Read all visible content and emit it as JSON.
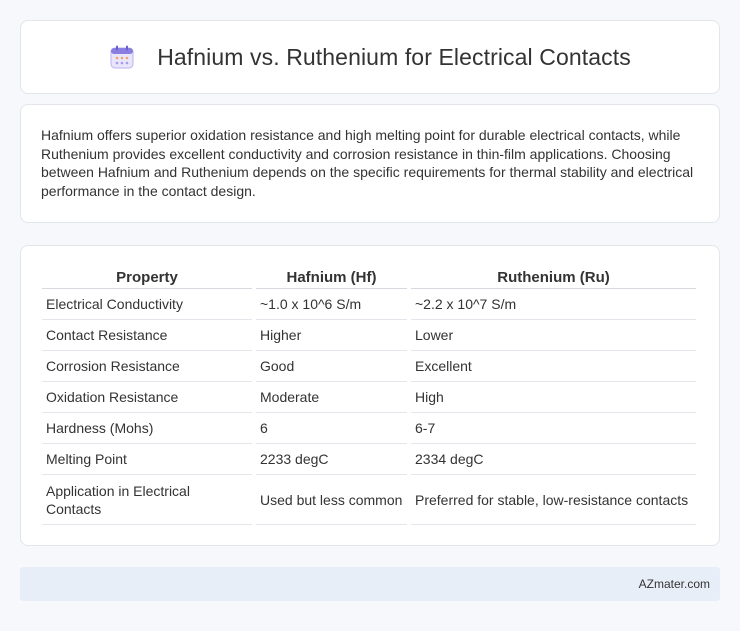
{
  "header": {
    "icon": "calendar-icon",
    "title": "Hafnium vs. Ruthenium for Electrical Contacts"
  },
  "intro": {
    "text": "Hafnium offers superior oxidation resistance and high melting point for durable electrical contacts, while Ruthenium provides excellent conductivity and corrosion resistance in thin-film applications. Choosing between Hafnium and Ruthenium depends on the specific requirements for thermal stability and electrical performance in the contact design."
  },
  "table": {
    "headers": [
      "Property",
      "Hafnium (Hf)",
      "Ruthenium (Ru)"
    ],
    "rows": [
      [
        "Electrical Conductivity",
        "~1.0 x 10^6 S/m",
        "~2.2 x 10^7 S/m"
      ],
      [
        "Contact Resistance",
        "Higher",
        "Lower"
      ],
      [
        "Corrosion Resistance",
        "Good",
        "Excellent"
      ],
      [
        "Oxidation Resistance",
        "Moderate",
        "High"
      ],
      [
        "Hardness (Mohs)",
        "6",
        "6-7"
      ],
      [
        "Melting Point",
        "2233 degC",
        "2334 degC"
      ],
      [
        "Application in Electrical Contacts",
        "Used but less common",
        "Preferred for stable, low-resistance contacts"
      ]
    ]
  },
  "footer": {
    "text": "AZmater.com"
  },
  "colors": {
    "background": "#f7f8fb",
    "card": "#ffffff",
    "footer_bg": "#e8eef8",
    "icon_accent": "#7b6fd6"
  }
}
